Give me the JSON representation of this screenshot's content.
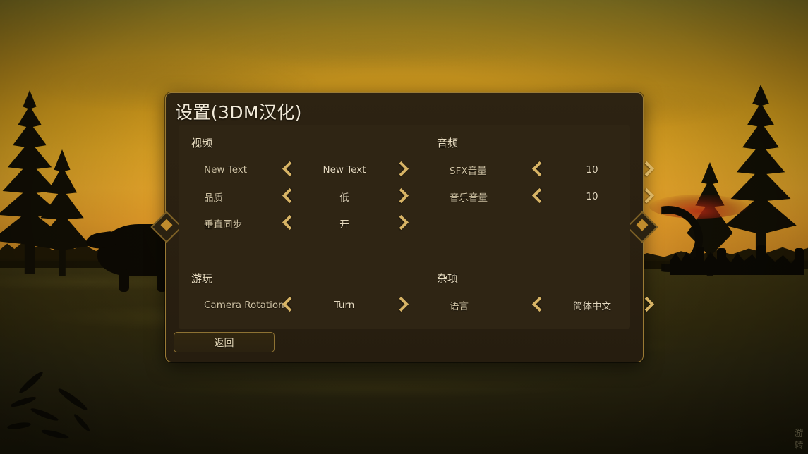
{
  "window": {
    "title": "设置(3DM汉化)"
  },
  "colors": {
    "panel_bg": "#2d2312",
    "panel_border": "#9a7a34",
    "inner_bg": "#2f2514",
    "accent_gold": "#d8b465",
    "title_text": "#f2ead8",
    "label_text": "#cfc2a3",
    "value_text": "#e3d7bd",
    "diamond_fill": "#c08c2d"
  },
  "groups": [
    {
      "name": "video",
      "title": "视频",
      "rows": [
        {
          "name": "new-text",
          "label": "New Text",
          "value": "New Text",
          "prev_icon": "chevron-left-icon",
          "next_icon": "chevron-right-icon"
        },
        {
          "name": "quality",
          "label": "品质",
          "value": "低",
          "prev_icon": "chevron-left-icon",
          "next_icon": "chevron-right-icon"
        },
        {
          "name": "vsync",
          "label": "垂直同步",
          "value": "开",
          "prev_icon": "chevron-left-icon",
          "next_icon": "chevron-right-icon"
        }
      ]
    },
    {
      "name": "audio",
      "title": "音频",
      "rows": [
        {
          "name": "sfx-volume",
          "label": "SFX音量",
          "value": "10",
          "prev_icon": "chevron-left-icon",
          "next_icon": "chevron-right-icon"
        },
        {
          "name": "music-volume",
          "label": "音乐音量",
          "value": "10",
          "prev_icon": "chevron-left-icon",
          "next_icon": "chevron-right-icon"
        }
      ]
    },
    {
      "name": "gameplay",
      "title": "游玩",
      "rows": [
        {
          "name": "camera-rotation",
          "label": "Camera Rotation",
          "value": "Turn",
          "prev_icon": "chevron-left-icon",
          "next_icon": "chevron-right-icon"
        }
      ]
    },
    {
      "name": "misc",
      "title": "杂项",
      "rows": [
        {
          "name": "language",
          "label": "语言",
          "value": "简体中文",
          "prev_icon": "chevron-left-icon",
          "next_icon": "chevron-right-icon"
        }
      ]
    }
  ],
  "footer": {
    "back_label": "返回"
  },
  "watermark": {
    "text": "游转"
  }
}
